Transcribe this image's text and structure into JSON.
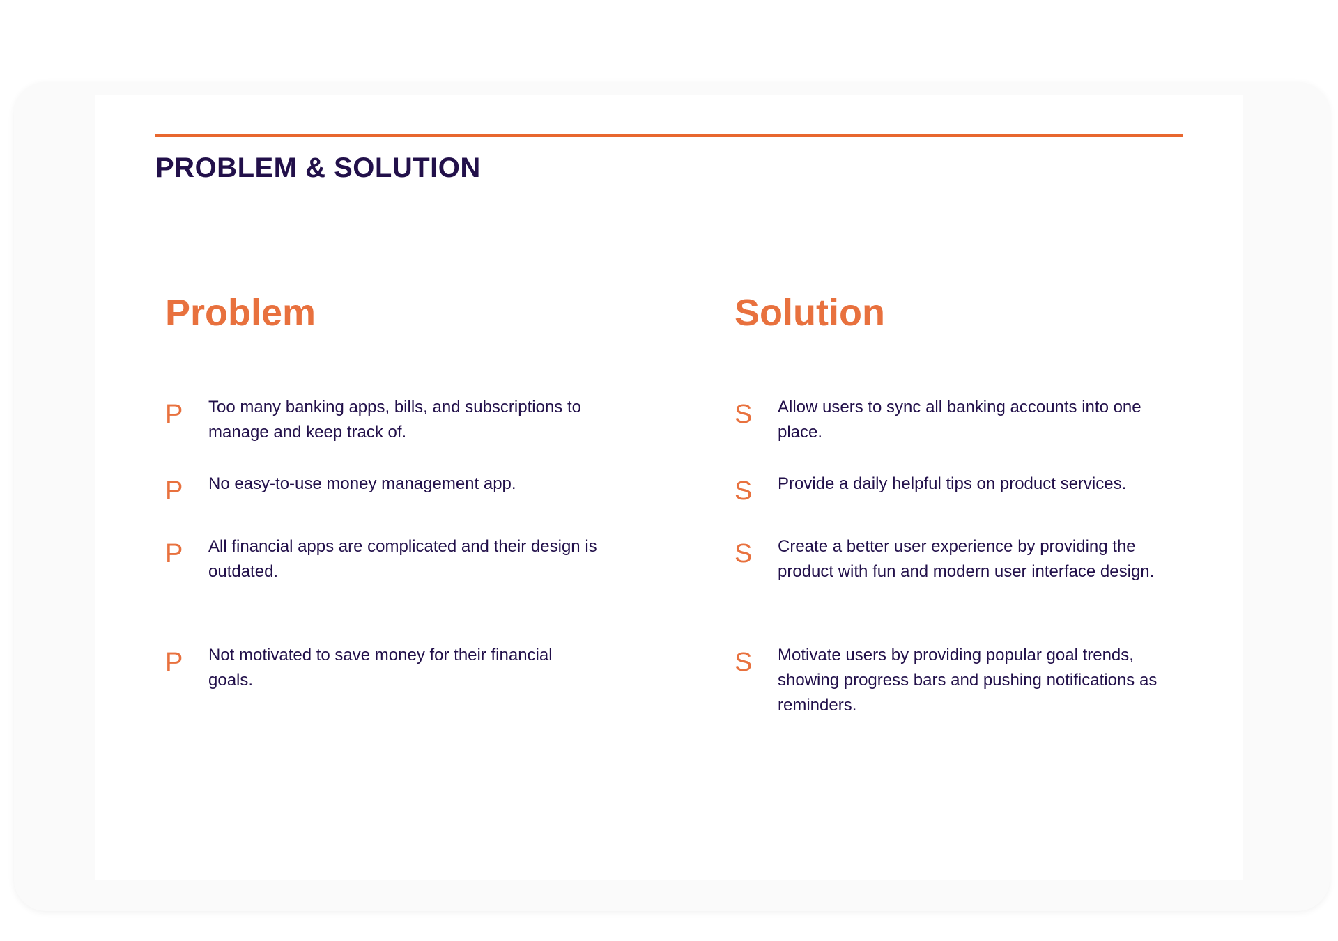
{
  "section_title": "PROBLEM & SOLUTION",
  "accent_color": "#e8672f",
  "title_color": "#22104a",
  "problem": {
    "heading": "Problem",
    "marker": "P",
    "items": [
      "Too many banking apps, bills, and subscriptions to manage and keep track of.",
      "No easy-to-use money management app.",
      "All financial apps are complicated and their design is outdated.",
      "Not motivated to save money for their financial goals."
    ]
  },
  "solution": {
    "heading": "Solution",
    "marker": "S",
    "items": [
      "Allow users to sync all banking accounts into one place.",
      "Provide a daily helpful tips on product services.",
      "Create a better user experience by providing the product with fun and modern user interface design.",
      "Motivate users by providing popular goal trends, showing progress bars and pushing notifications as reminders."
    ]
  }
}
